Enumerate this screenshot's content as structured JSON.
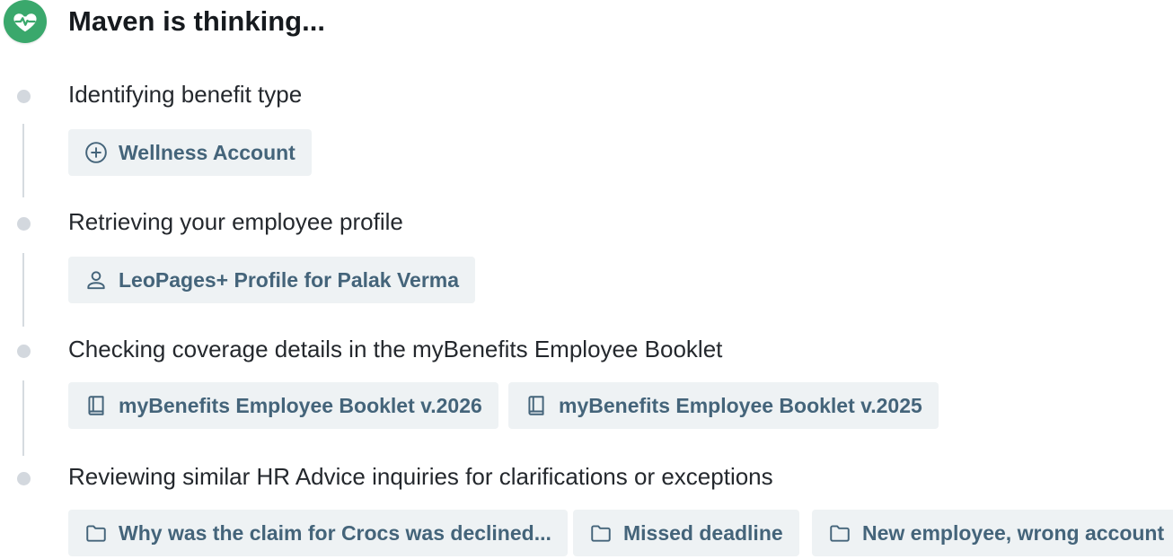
{
  "header": {
    "title": "Maven is thinking...",
    "logo_icon": "heart-pulse-icon",
    "logo_color": "#3aa86c"
  },
  "steps": [
    {
      "label": "Identifying benefit type",
      "chips": [
        {
          "label": "Wellness Account",
          "icon": "plus-circle-icon"
        }
      ]
    },
    {
      "label": "Retrieving your employee profile",
      "chips": [
        {
          "label": "LeoPages+ Profile for Palak Verma",
          "icon": "user-icon"
        }
      ]
    },
    {
      "label": "Checking coverage details in the myBenefits Employee Booklet",
      "chips": [
        {
          "label": "myBenefits Employee Booklet v.2026",
          "icon": "book-icon"
        },
        {
          "label": "myBenefits Employee Booklet v.2025",
          "icon": "book-icon"
        }
      ]
    },
    {
      "label": "Reviewing similar HR Advice inquiries for clarifications or exceptions",
      "chips": [
        {
          "label": "Why was the claim for Crocs was declined...",
          "icon": "folder-icon"
        },
        {
          "label": "Missed deadline",
          "icon": "folder-icon"
        },
        {
          "label": "New employee, wrong account",
          "icon": "folder-icon"
        }
      ]
    }
  ],
  "colors": {
    "chip_background": "#eef2f4",
    "chip_text": "#44647a",
    "timeline_dot": "#d3d8de"
  }
}
